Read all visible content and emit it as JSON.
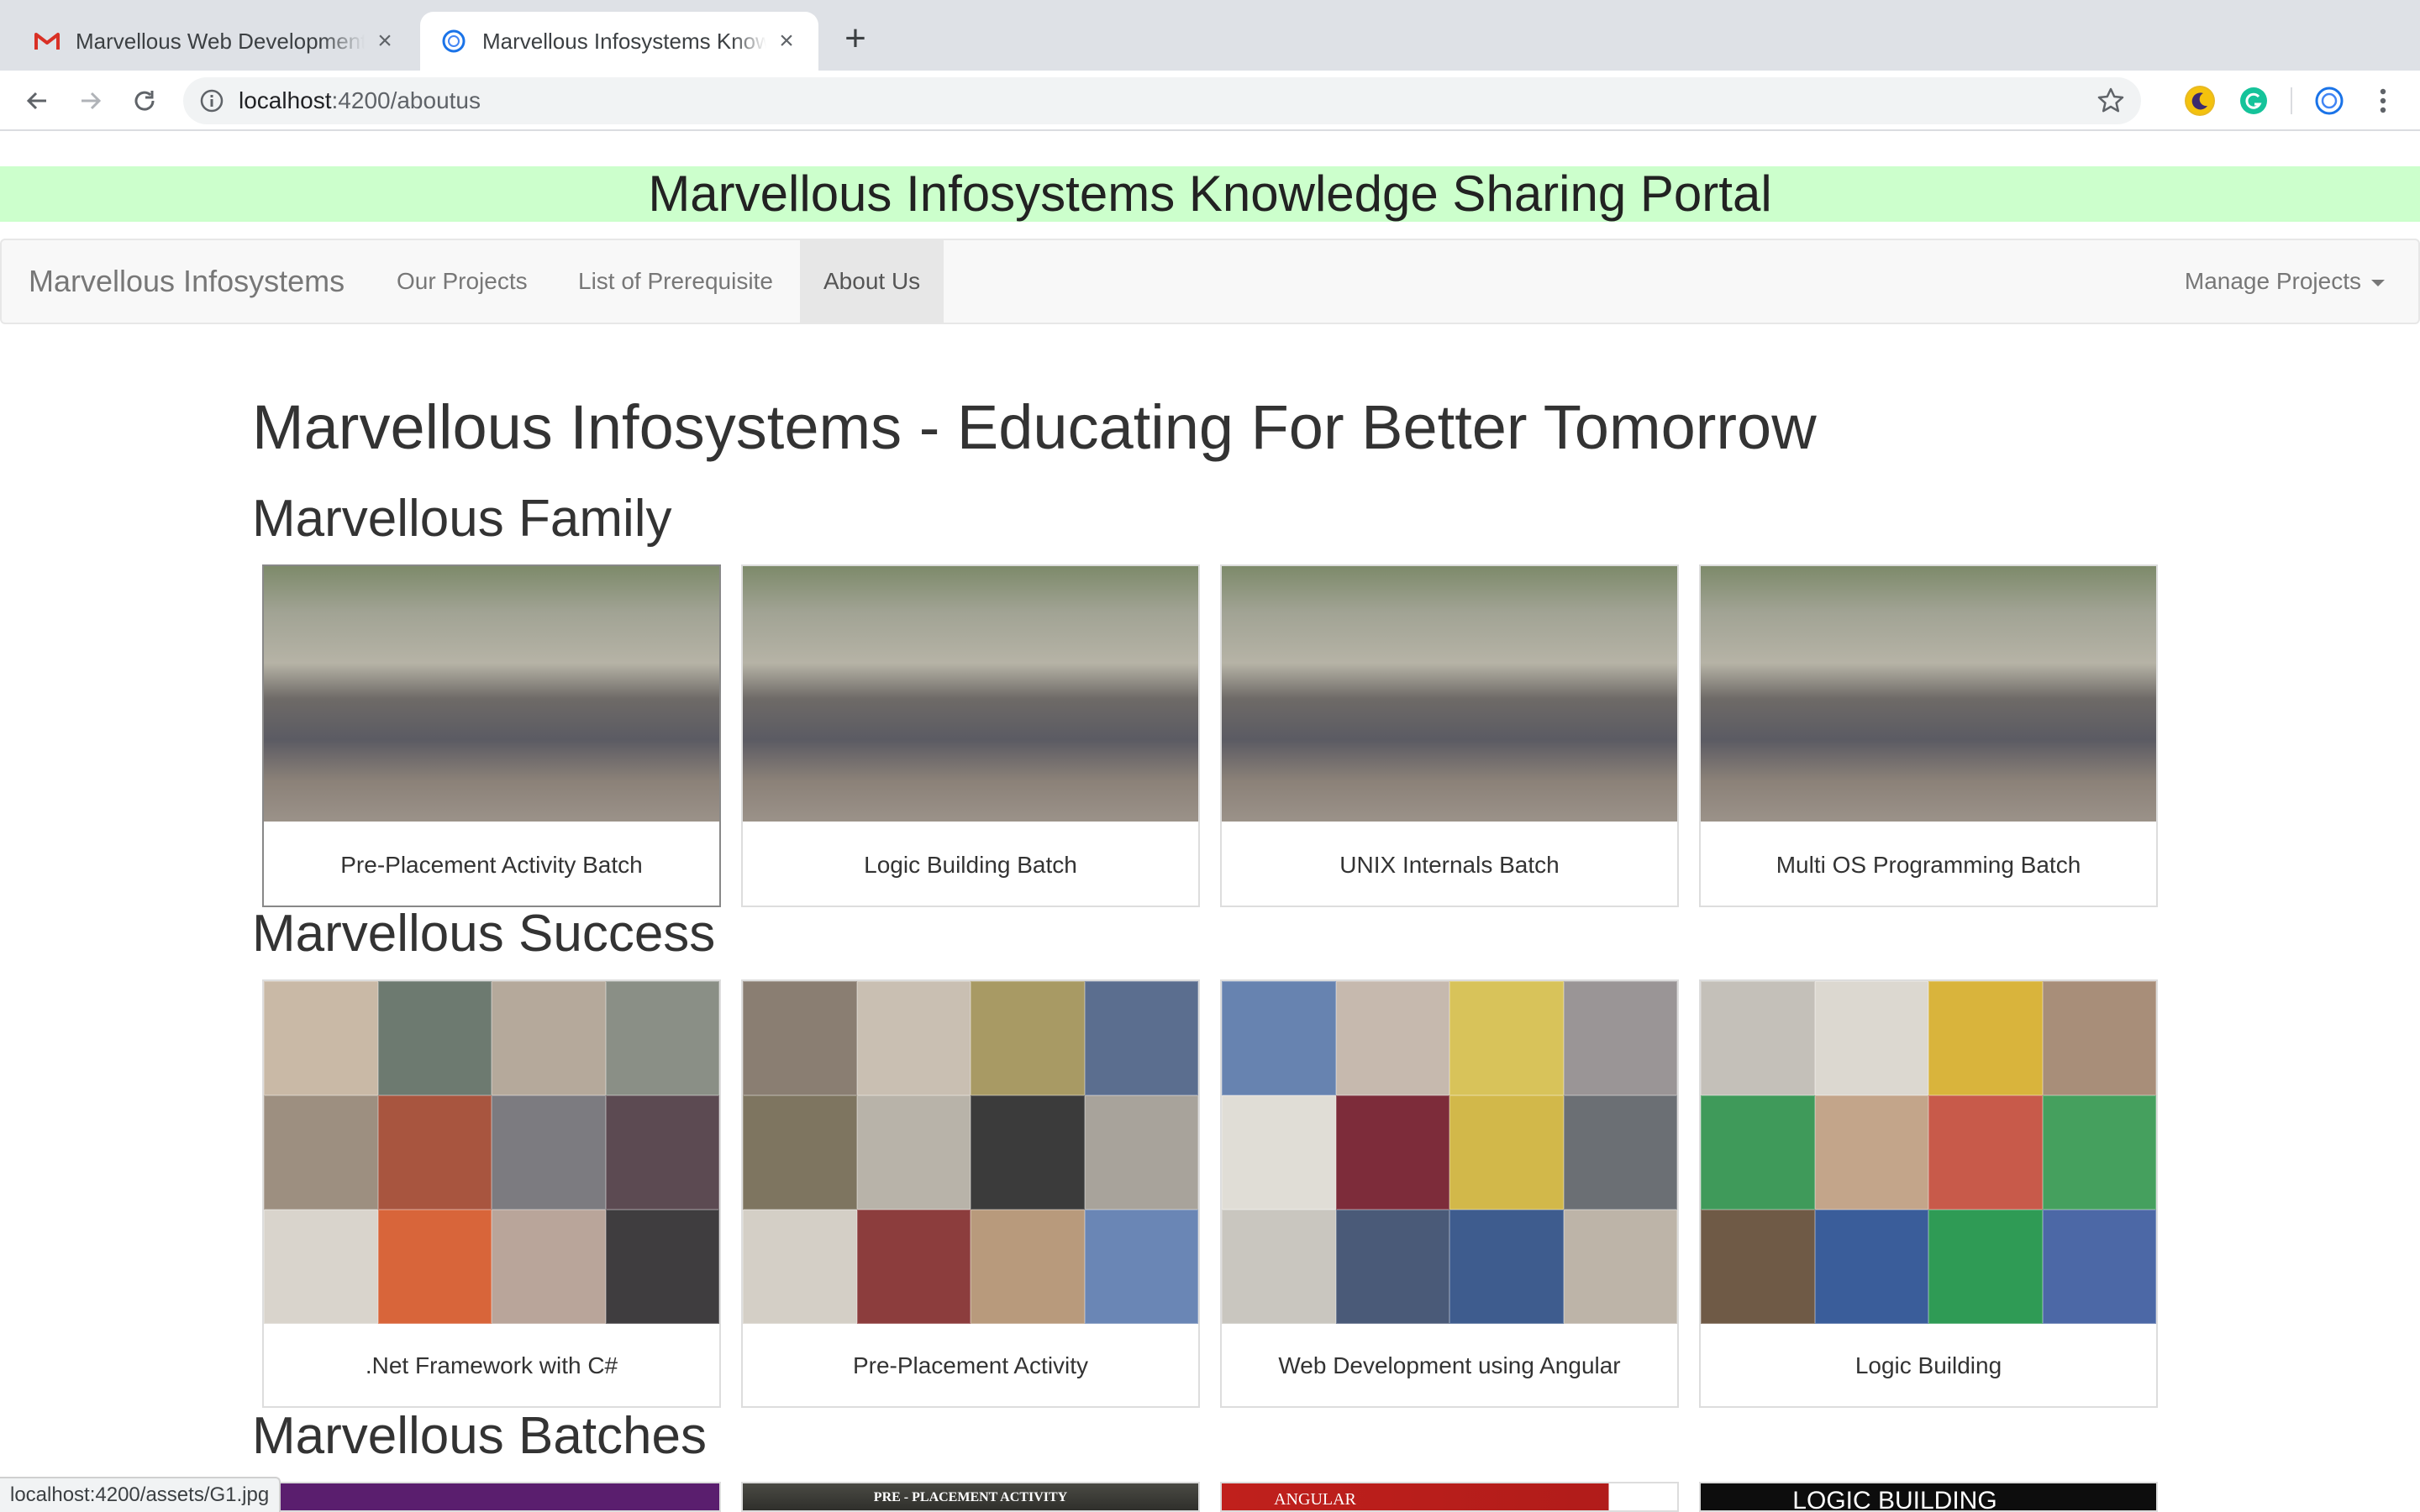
{
  "browser": {
    "tabs": [
      {
        "title": "Marvellous Web Development",
        "favicon": "gmail-icon",
        "active": false
      },
      {
        "title": "Marvellous Infosystems Knowledge Sharing Portal",
        "favicon": "portal-icon",
        "active": true
      }
    ],
    "new_tab": "+",
    "close_glyph": "×",
    "url_host": "localhost",
    "url_path": ":4200/aboutus",
    "extensions": [
      "moon-extension-icon",
      "grammarly-icon",
      "portal-extension-icon"
    ],
    "status_url": "localhost:4200/assets/G1.jpg"
  },
  "banner": {
    "title": "Marvellous Infosystems Knowledge Sharing Portal",
    "color": "#ccffcc"
  },
  "navbar": {
    "brand": "Marvellous Infosystems",
    "links": [
      "Our Projects",
      "List of Prerequisite",
      "About Us"
    ],
    "active": "About Us",
    "dropdown": "Manage Projects"
  },
  "page": {
    "heading": "Marvellous Infosystems - Educating For Better Tomorrow",
    "sections": {
      "family": {
        "title": "Marvellous Family",
        "cards": [
          "Pre-Placement Activity Batch",
          "Logic Building Batch",
          "UNIX Internals Batch",
          "Multi OS Programming Batch"
        ]
      },
      "success": {
        "title": "Marvellous Success",
        "cards": [
          ".Net Framework with C#",
          "Pre-Placement Activity",
          "Web Development using Angular",
          "Logic Building"
        ]
      },
      "batches": {
        "title": "Marvellous Batches",
        "strips": [
          "",
          "PRE - PLACEMENT ACTIVITY",
          "ANGULAR",
          "LOGIC BUILDING"
        ]
      }
    }
  }
}
